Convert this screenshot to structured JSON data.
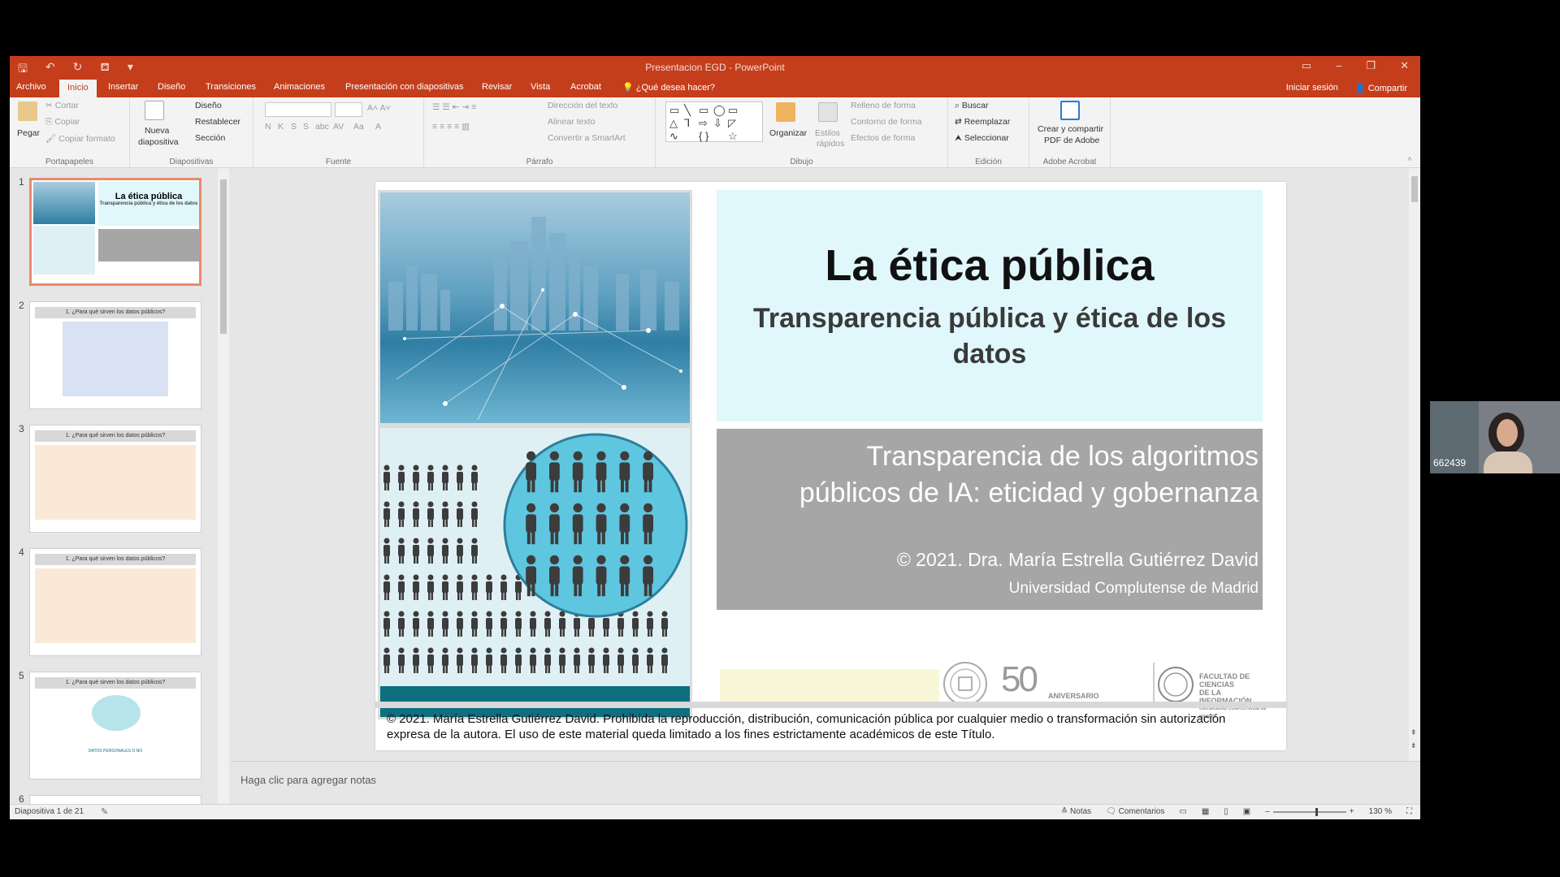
{
  "window": {
    "title": "Presentacion EGD - PowerPoint"
  },
  "tabs": [
    "Archivo",
    "Inicio",
    "Insertar",
    "Diseño",
    "Transiciones",
    "Animaciones",
    "Presentación con diapositivas",
    "Revisar",
    "Vista",
    "Acrobat"
  ],
  "tell_me": "¿Qué desea hacer?",
  "account": {
    "signin": "Iniciar sesión",
    "share": "Compartir"
  },
  "ribbon": {
    "portapapeles": {
      "paste": "Pegar",
      "cut": "Cortar",
      "copy": "Copiar",
      "format_painter": "Copiar formato",
      "label": "Portapapeles"
    },
    "diapositivas": {
      "new_slide_1": "Nueva",
      "new_slide_2": "diapositiva",
      "layout": "Diseño",
      "reset": "Restablecer",
      "section": "Sección",
      "label": "Diapositivas"
    },
    "fuente": {
      "label": "Fuente",
      "bold": "N",
      "italic": "K",
      "underline": "S",
      "shadow": "S",
      "strike": "abc",
      "spacing": "AV",
      "case": "Aa",
      "color": "A"
    },
    "parrafo": {
      "text_direction": "Dirección del texto",
      "align_text": "Alinear texto",
      "smartart": "Convertir a SmartArt",
      "label": "Párrafo"
    },
    "dibujo": {
      "arrange": "Organizar",
      "quick_styles_1": "Estilos",
      "quick_styles_2": "rápidos",
      "shape_fill": "Relleno de forma",
      "shape_outline": "Contorno de forma",
      "shape_effects": "Efectos de forma",
      "label": "Dibujo"
    },
    "edicion": {
      "find": "Buscar",
      "replace": "Reemplazar",
      "select": "Seleccionar",
      "label": "Edición"
    },
    "acrobat": {
      "create_1": "Crear y compartir",
      "create_2": "PDF de Adobe",
      "label": "Adobe Acrobat"
    }
  },
  "thumbnails": [
    {
      "num": "1",
      "title": "La ética pública",
      "sub": "Transparencia pública y ética de los datos"
    },
    {
      "num": "2",
      "title": "1. ¿Para qué sirven los datos públicos?",
      "sub": ""
    },
    {
      "num": "3",
      "title": "1. ¿Para qué sirven los datos públicos?",
      "sub": ""
    },
    {
      "num": "4",
      "title": "1. ¿Para qué sirven los datos públicos?",
      "sub": ""
    },
    {
      "num": "5",
      "title": "1. ¿Para qué sirven los datos públicos?",
      "sub": "DATOS PERSONALES O NO"
    },
    {
      "num": "6",
      "title": "",
      "sub": ""
    }
  ],
  "slide": {
    "title": "La ética pública",
    "subtitle": "Transparencia pública y ética de los datos",
    "box_line1": "Transparencia de los algoritmos",
    "box_line2": "públicos de IA: eticidad y gobernanza",
    "author": "© 2021. Dra. María Estrella Gutiérrez David",
    "university": "Universidad Complutense de Madrid",
    "logo_50": "50",
    "logo_50_sub": "ANIVERSARIO",
    "faculty_line1": "FACULTAD DE CIENCIAS",
    "faculty_line2": "DE LA INFORMACIÓN",
    "faculty_line3": "UNIVERSIDAD COMPLUTENSE DE MADRID",
    "copyright_line1": "© 2021. María Estrella Gutiérrez David. Prohibida la reproducción, distribución, comunicación pública por cualquier medio o transformación sin autorización",
    "copyright_line2": "expresa de la autora. El uso de este material queda limitado a los fines estrictamente académicos de este Título."
  },
  "notes_placeholder": "Haga clic para agregar notas",
  "status": {
    "slide_of": "Diapositiva 1 de 21",
    "notes": "Notas",
    "comments": "Comentarios",
    "zoom": "130 %"
  },
  "webcam": {
    "id": "662439"
  },
  "colors": {
    "accent": "#c43e1c",
    "teal": "#0d6f80",
    "slide_title_bg": "#e0f7fb",
    "slide_box_bg": "#a6a6a6"
  }
}
